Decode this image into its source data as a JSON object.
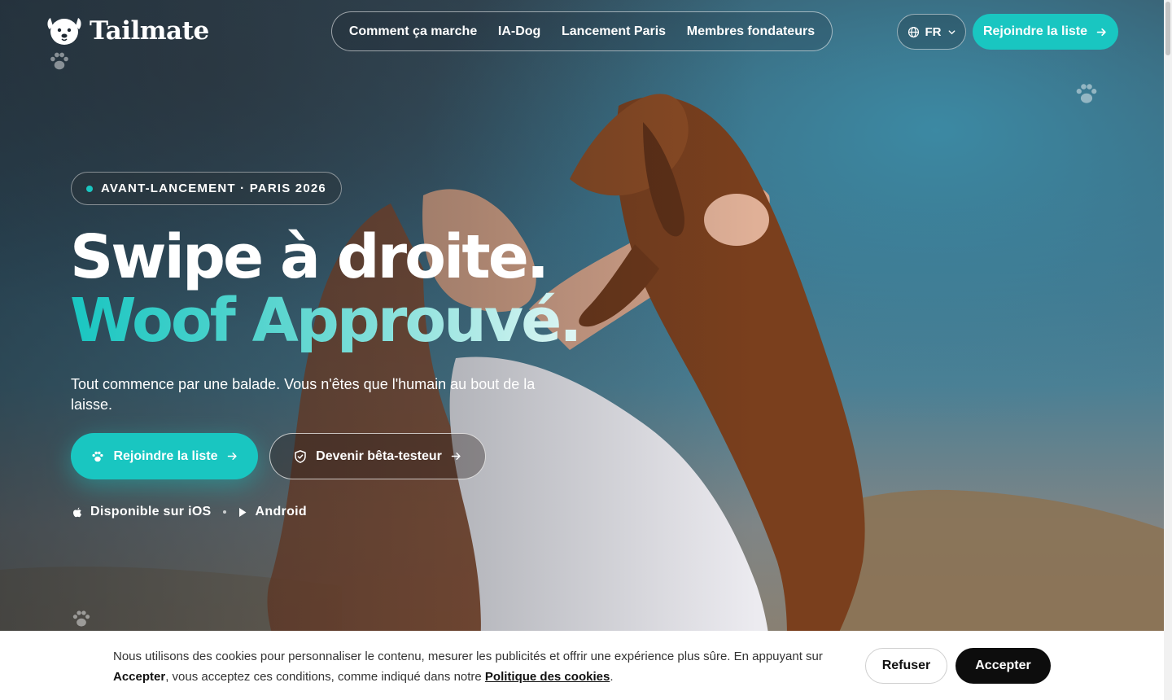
{
  "brand": {
    "name": "Tailmate"
  },
  "nav": {
    "items": [
      {
        "label": "Comment ça marche"
      },
      {
        "label": "IA-Dog"
      },
      {
        "label": "Lancement Paris"
      },
      {
        "label": "Membres fondateurs"
      }
    ]
  },
  "header": {
    "language": "FR",
    "join_label": "Rejoindre la liste"
  },
  "hero": {
    "badge": "AVANT-LANCEMENT · PARIS 2026",
    "title_line1": "Swipe à droite.",
    "title_line2": "Woof Approuvé.",
    "lead": "Tout commence par une balade. Vous n'êtes que l'humain au bout de la laisse.",
    "cta_primary": "Rejoindre la liste",
    "cta_secondary": "Devenir bêta-testeur",
    "platform_ios": "Disponible sur iOS",
    "platform_android": "Android"
  },
  "cookie": {
    "text_before": "Nous utilisons des cookies pour personnaliser le contenu, mesurer les publicités et offrir une expérience plus sûre. En appuyant sur ",
    "accept_word": "Accepter",
    "text_middle": ", vous acceptez ces conditions, comme indiqué dans notre ",
    "policy_link": "Politique des cookies",
    "text_after": ".",
    "refuse_label": "Refuser",
    "accept_label": "Accepter"
  },
  "colors": {
    "accent": "#19c6c1",
    "accept_button": "#0d0d0d"
  },
  "icons": {
    "logo": "dog-face-icon",
    "language": "globe-icon",
    "chevron": "chevron-down-icon",
    "arrow": "arrow-right-icon",
    "paw": "paw-icon",
    "shield": "shield-check-icon",
    "apple": "apple-icon",
    "play": "play-store-icon"
  }
}
